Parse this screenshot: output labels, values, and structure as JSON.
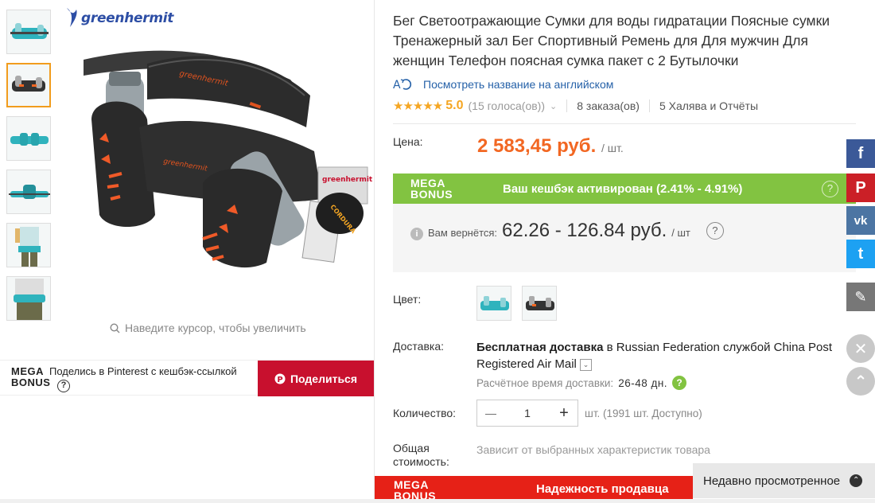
{
  "gallery": {
    "brand": "greenhermit",
    "zoom_hint": "Наведите курсор, чтобы увеличить",
    "thumbnails": [
      "teal-belt",
      "black-belt",
      "teal-belt-front",
      "teal-belt-side",
      "model-back",
      "model-waist"
    ]
  },
  "share": {
    "mega_line1": "MEGA",
    "mega_line2": "BONUS",
    "text": "Поделись в Pinterest с кешбэк-ссылкой",
    "q": "?",
    "button_label": "Поделиться",
    "button_color": "#c8102e"
  },
  "product": {
    "title": "Бег Светоотражающие Сумки для воды гидратации Поясные сумки Тренажерный зал Бег Спортивный Ремень для Для мужчин Для женщин Телефон поясная сумка пакет с 2 Бутылочки",
    "translate_link": "Посмотреть название на английском",
    "stars": "★★★★★",
    "rating": "5.0",
    "votes": "(15 голоса(ов))",
    "orders": "8 заказа(ов)",
    "reviews": "5 Халява и Отчёты"
  },
  "price": {
    "label": "Цена:",
    "value": "2 583,45 руб.",
    "unit": "/ шт.",
    "color": "#f26722"
  },
  "mega_bonus": {
    "line1": "MEGA",
    "line2": "BONUS",
    "cashback": "Ваш кешбэк активирован (2.41% - 4.91%)",
    "q": "?",
    "return_label": "Вам вернётся:",
    "return_value": "62.26 - 126.84 руб.",
    "return_unit": "/ шт",
    "info": "i",
    "color": "#82c341"
  },
  "color": {
    "label": "Цвет:",
    "options": [
      "teal",
      "black"
    ]
  },
  "shipping": {
    "label": "Доставка:",
    "text_bold": "Бесплатная доставка",
    "text_rest": " в Russian Federation службой China Post Registered Air Mail",
    "dropdown": "⌄",
    "time_label": "Расчётное время доставки:",
    "time_value": "26-48 дн.",
    "help": "?"
  },
  "quantity": {
    "label": "Количество:",
    "minus": "—",
    "value": "1",
    "plus": "+",
    "available": "шт. (1991 шт. Доступно)"
  },
  "total": {
    "label_line1": "Общая",
    "label_line2": "стоимость:",
    "value": "Зависит от выбранных характеристик товара"
  },
  "seller_bar": {
    "line1": "MEGA",
    "line2": "BONUS",
    "text": "Надежность продавца",
    "color": "#e62117"
  },
  "recent": {
    "label": "Недавно просмотренное",
    "chevron": "⌃"
  },
  "social": [
    {
      "name": "facebook",
      "glyph": "f",
      "color": "#3b5998"
    },
    {
      "name": "pinterest",
      "glyph": "P",
      "color": "#cb2027"
    },
    {
      "name": "vk",
      "glyph": "vk",
      "color": "#4c75a3"
    },
    {
      "name": "twitter",
      "glyph": "t",
      "color": "#1da1f2"
    },
    {
      "name": "edit",
      "glyph": "✎",
      "color": "#777777"
    }
  ],
  "side_buttons": {
    "close": "✕",
    "up": "⌃"
  }
}
